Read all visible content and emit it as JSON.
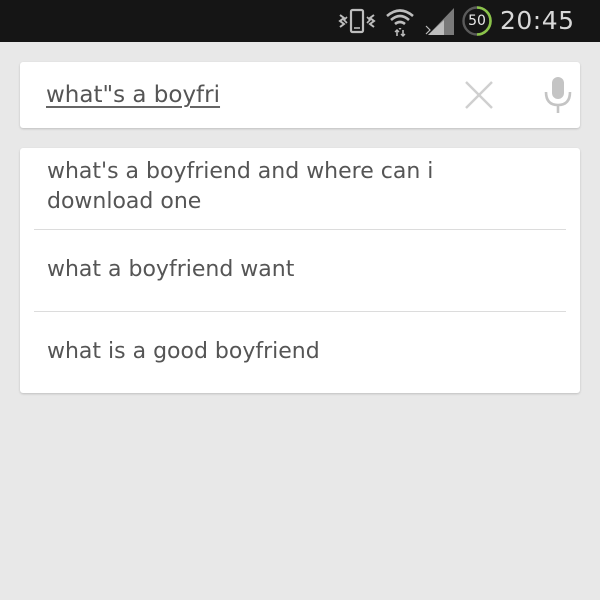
{
  "status_bar": {
    "clock": "20:45",
    "battery_level": "50",
    "icons": [
      "vibrate-icon",
      "wifi-icon",
      "cell-signal-icon",
      "battery-icon"
    ],
    "battery_color": "#8bc34a"
  },
  "search": {
    "query": "what\"s a boyfri",
    "clear_icon": "close-icon",
    "voice_icon": "microphone-icon"
  },
  "suggestions": [
    "what's a boyfriend and where can i download one",
    "what a boyfriend want",
    "what is a good boyfriend"
  ],
  "colors": {
    "background": "#e8e8e8",
    "status_bar": "#151515",
    "card": "#ffffff",
    "text": "#555555",
    "icon": "#cccccc"
  }
}
